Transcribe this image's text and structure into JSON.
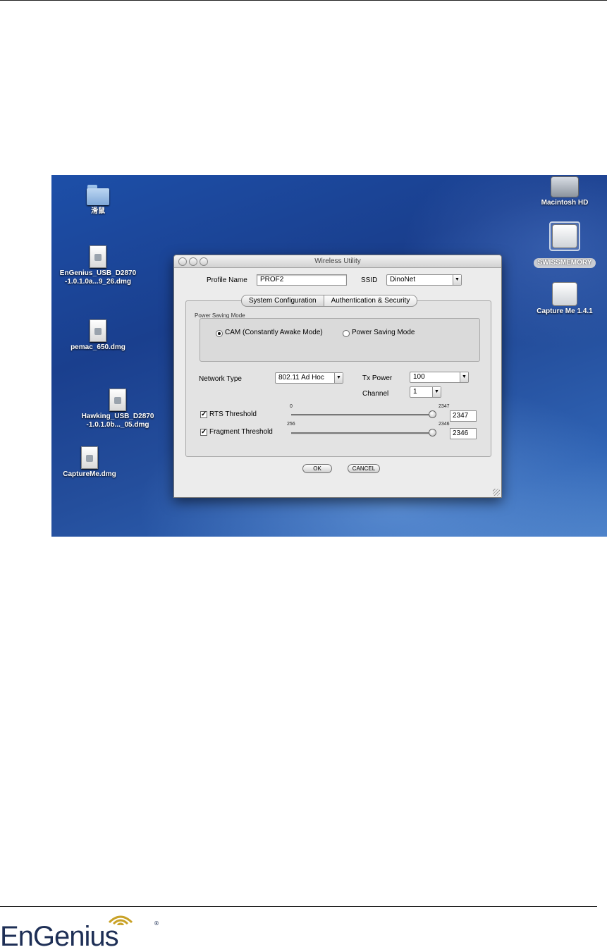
{
  "desktop": {
    "icons": [
      {
        "label": "滑鼠",
        "kind": "folder-icon"
      },
      {
        "label": "EnGenius_USB_D2870\n-1.0.1.0a...9_26.dmg",
        "kind": "dmg-icon"
      },
      {
        "label": "pemac_650.dmg",
        "kind": "dmg-icon"
      },
      {
        "label": "Hawking_USB_D2870\n-1.0.1.0b..._05.dmg",
        "kind": "dmg-icon"
      },
      {
        "label": "CaptureMe.dmg",
        "kind": "dmg-icon"
      },
      {
        "label": "Macintosh HD",
        "kind": "hard-drive-icon"
      },
      {
        "label": "SWISSMEMORY",
        "kind": "usb-drive-icon"
      },
      {
        "label": "Capture Me 1.4.1",
        "kind": "disk-image-drive-icon"
      }
    ]
  },
  "window": {
    "title": "Wireless Utility",
    "profile_name_label": "Profile Name",
    "profile_name_value": "PROF2",
    "ssid_label": "SSID",
    "ssid_value": "DinoNet",
    "tabs": [
      "System Configuration",
      "Authentication & Security"
    ],
    "power_saving": {
      "group_title": "Power Saving Mode",
      "options": [
        "CAM (Constantly Awake Mode)",
        "Power Saving Mode"
      ],
      "selected": 0
    },
    "network_type_label": "Network Type",
    "network_type_value": "802.11 Ad Hoc",
    "tx_power_label": "Tx Power",
    "tx_power_value": "100",
    "channel_label": "Channel",
    "channel_value": "1",
    "rts": {
      "label": "RTS Threshold",
      "checked": true,
      "min_label": "0",
      "max_label": "2347",
      "value": "2347"
    },
    "fragment": {
      "label": "Fragment Threshold",
      "checked": true,
      "min_label": "256",
      "max_label": "2346",
      "value": "2346"
    },
    "ok_label": "OK",
    "cancel_label": "CANCEL"
  },
  "footer": {
    "logo_text": "EnGenius",
    "registered": "®"
  },
  "colors": {
    "desktop_blue": "#1d4fa8",
    "logo_navy": "#1e2f56"
  }
}
